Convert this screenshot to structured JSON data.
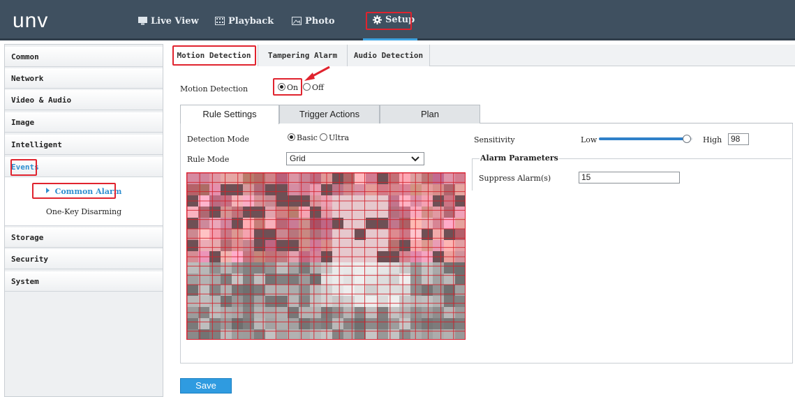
{
  "brand": {
    "logo": "unv"
  },
  "nav": [
    {
      "label": "Live View",
      "icon": "monitor-icon"
    },
    {
      "label": "Playback",
      "icon": "film-icon"
    },
    {
      "label": "Photo",
      "icon": "image-icon"
    },
    {
      "label": "Setup",
      "icon": "gear-icon",
      "active": true
    }
  ],
  "sidebar": {
    "items": [
      "Common",
      "Network",
      "Video & Audio",
      "Image",
      "Intelligent",
      "Events",
      "Storage",
      "Security",
      "System"
    ],
    "events_sub": [
      "Common Alarm",
      "One-Key Disarming"
    ]
  },
  "tabs": [
    "Motion Detection",
    "Tampering Alarm",
    "Audio Detection"
  ],
  "motion": {
    "label": "Motion Detection",
    "on_label": "On",
    "off_label": "Off",
    "selected": "On"
  },
  "subtabs": [
    "Rule Settings",
    "Trigger Actions",
    "Plan"
  ],
  "rule": {
    "detection_mode_label": "Detection Mode",
    "basic_label": "Basic",
    "ultra_label": "Ultra",
    "detection_mode_selected": "Basic",
    "rule_mode_label": "Rule Mode",
    "rule_mode_value": "Grid"
  },
  "sensitivity": {
    "label": "Sensitivity",
    "low": "Low",
    "high": "High",
    "value": "98",
    "level": 0.98
  },
  "alarm": {
    "legend": "Alarm Parameters",
    "suppress_label": "Suppress Alarm(s)",
    "suppress_value": "15"
  },
  "save_label": "Save",
  "colors": {
    "topbar": "#3f5060",
    "accent": "#2f9be0",
    "highlight": "#e0232e",
    "grid": "#d2202a"
  }
}
